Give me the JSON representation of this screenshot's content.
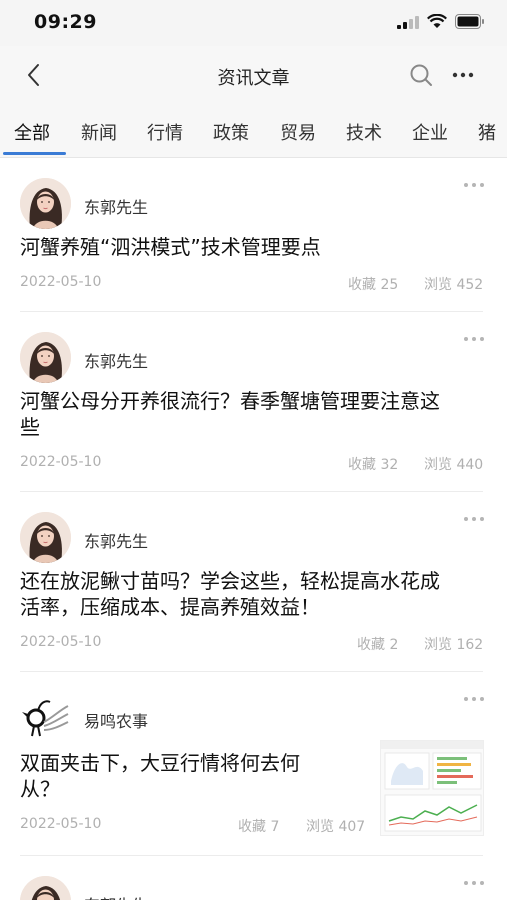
{
  "status": {
    "time": "09:29"
  },
  "nav": {
    "title": "资讯文章"
  },
  "tabs": [
    "全部",
    "新闻",
    "行情",
    "政策",
    "贸易",
    "技术",
    "企业",
    "猪"
  ],
  "articles": [
    {
      "author": "东郭先生",
      "title_lines": [
        "河蟹养殖“泗洪模式”技术管理要点"
      ],
      "date": "2022-05-10",
      "favorites": "收藏 25",
      "views": "浏览 452"
    },
    {
      "author": "东郭先生",
      "title_lines": [
        "河蟹公母分开养很流行？春季蟹塘管理要注意这",
        "些"
      ],
      "date": "2022-05-10",
      "favorites": "收藏 32",
      "views": "浏览 440"
    },
    {
      "author": "东郭先生",
      "title_lines": [
        "还在放泥鳅寸苗吗？学会这些，轻松提高水花成",
        "活率，压缩成本、提高养殖效益！"
      ],
      "date": "2022-05-10",
      "favorites": "收藏 2",
      "views": "浏览 162"
    },
    {
      "author": "易鸣农事",
      "title_lines": [
        "双面夹击下，大豆行情将何去何",
        "从？"
      ],
      "date": "2022-05-10",
      "favorites": "收藏 7",
      "views": "浏览 407"
    },
    {
      "author": "东郭先生"
    }
  ],
  "colors": {
    "accent": "#3a7bd5",
    "meta": "#b0b0b0"
  }
}
